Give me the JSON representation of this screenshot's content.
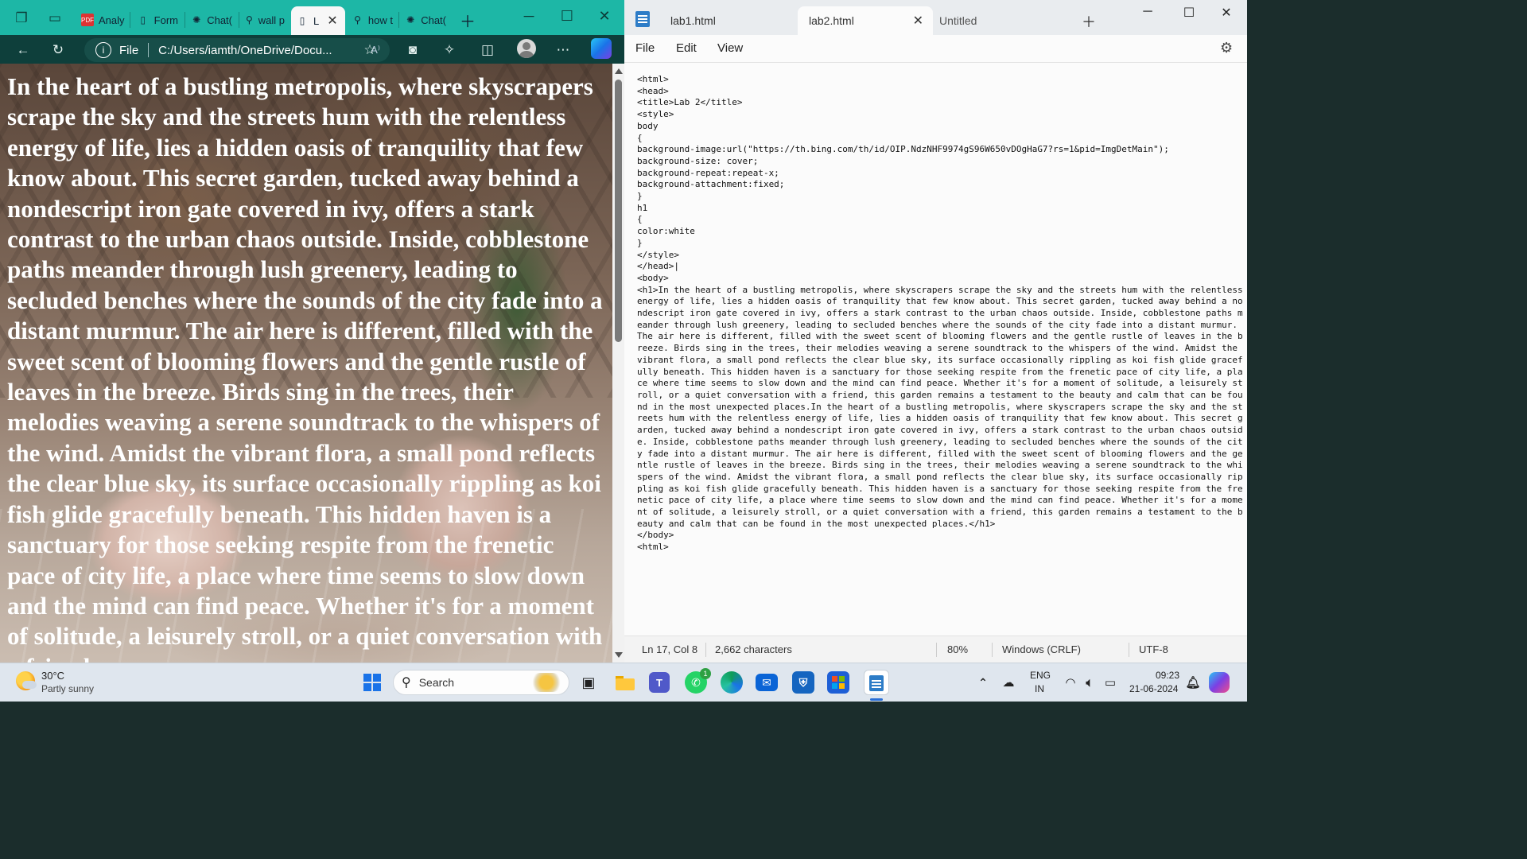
{
  "browser": {
    "tabs": [
      {
        "label": "Analy"
      },
      {
        "label": "Form"
      },
      {
        "label": "Chat("
      },
      {
        "label": "wall p"
      },
      {
        "label": "L"
      },
      {
        "label": "how t"
      },
      {
        "label": "Chat("
      }
    ],
    "address_scheme": "File",
    "address_url": "C:/Users/iamth/OneDrive/Docu...",
    "read_aloud": "A⁾",
    "h1": "In the heart of a bustling metropolis, where skyscrapers scrape the sky and the streets hum with the relentless energy of life, lies a hidden oasis of tranquility that few know about. This secret garden, tucked away behind a nondescript iron gate covered in ivy, offers a stark contrast to the urban chaos outside. Inside, cobblestone paths meander through lush greenery, leading to secluded benches where the sounds of the city fade into a distant murmur. The air here is different, filled with the sweet scent of blooming flowers and the gentle rustle of leaves in the breeze. Birds sing in the trees, their melodies weaving a serene soundtrack to the whispers of the wind. Amidst the vibrant flora, a small pond reflects the clear blue sky, its surface occasionally rippling as koi fish glide gracefully beneath. This hidden haven is a sanctuary for those seeking respite from the frenetic pace of city life, a place where time seems to slow down and the mind can find peace. Whether it's for a moment of solitude, a leisurely stroll, or a quiet conversation with a friend"
  },
  "notepad": {
    "tabs": [
      {
        "label": "lab1.html"
      },
      {
        "label": "lab2.html"
      },
      {
        "label": "Untitled"
      }
    ],
    "menu": {
      "file": "File",
      "edit": "Edit",
      "view": "View"
    },
    "code": "<html>\n<head>\n<title>Lab 2</title>\n<style>\nbody\n{\nbackground-image:url(\"https://th.bing.com/th/id/OIP.NdzNHF9974gS96W650vDOgHaG7?rs=1&pid=ImgDetMain\");\nbackground-size: cover;\nbackground-repeat:repeat-x;\nbackground-attachment:fixed;\n}\nh1\n{\ncolor:white\n}\n</style>\n</head>|\n<body>\n<h1>In the heart of a bustling metropolis, where skyscrapers scrape the sky and the streets hum with the relentless energy of life, lies a hidden oasis of tranquility that few know about. This secret garden, tucked away behind a nondescript iron gate covered in ivy, offers a stark contrast to the urban chaos outside. Inside, cobblestone paths meander through lush greenery, leading to secluded benches where the sounds of the city fade into a distant murmur. The air here is different, filled with the sweet scent of blooming flowers and the gentle rustle of leaves in the breeze. Birds sing in the trees, their melodies weaving a serene soundtrack to the whispers of the wind. Amidst the vibrant flora, a small pond reflects the clear blue sky, its surface occasionally rippling as koi fish glide gracefully beneath. This hidden haven is a sanctuary for those seeking respite from the frenetic pace of city life, a place where time seems to slow down and the mind can find peace. Whether it's for a moment of solitude, a leisurely stroll, or a quiet conversation with a friend, this garden remains a testament to the beauty and calm that can be found in the most unexpected places.In the heart of a bustling metropolis, where skyscrapers scrape the sky and the streets hum with the relentless energy of life, lies a hidden oasis of tranquility that few know about. This secret garden, tucked away behind a nondescript iron gate covered in ivy, offers a stark contrast to the urban chaos outside. Inside, cobblestone paths meander through lush greenery, leading to secluded benches where the sounds of the city fade into a distant murmur. The air here is different, filled with the sweet scent of blooming flowers and the gentle rustle of leaves in the breeze. Birds sing in the trees, their melodies weaving a serene soundtrack to the whispers of the wind. Amidst the vibrant flora, a small pond reflects the clear blue sky, its surface occasionally rippling as koi fish glide gracefully beneath. This hidden haven is a sanctuary for those seeking respite from the frenetic pace of city life, a place where time seems to slow down and the mind can find peace. Whether it's for a moment of solitude, a leisurely stroll, or a quiet conversation with a friend, this garden remains a testament to the beauty and calm that can be found in the most unexpected places.</h1>\n</body>\n<html>",
    "status": {
      "position": "Ln 17, Col 8",
      "characters": "2,662 characters",
      "zoom": "80%",
      "line_ending": "Windows (CRLF)",
      "encoding": "UTF-8"
    }
  },
  "taskbar": {
    "temperature": "30°C",
    "condition": "Partly sunny",
    "search_label": "Search",
    "whatsapp_badge": "1",
    "lang_primary": "ENG",
    "lang_secondary": "IN",
    "time": "09:23",
    "date": "21-06-2024"
  },
  "colors": {
    "browser_frame": "#1db7a6",
    "browser_toolbar": "#0e3f3b",
    "notepad_bg": "#fbfbfb",
    "taskbar_bg": "#dfe6ee"
  }
}
